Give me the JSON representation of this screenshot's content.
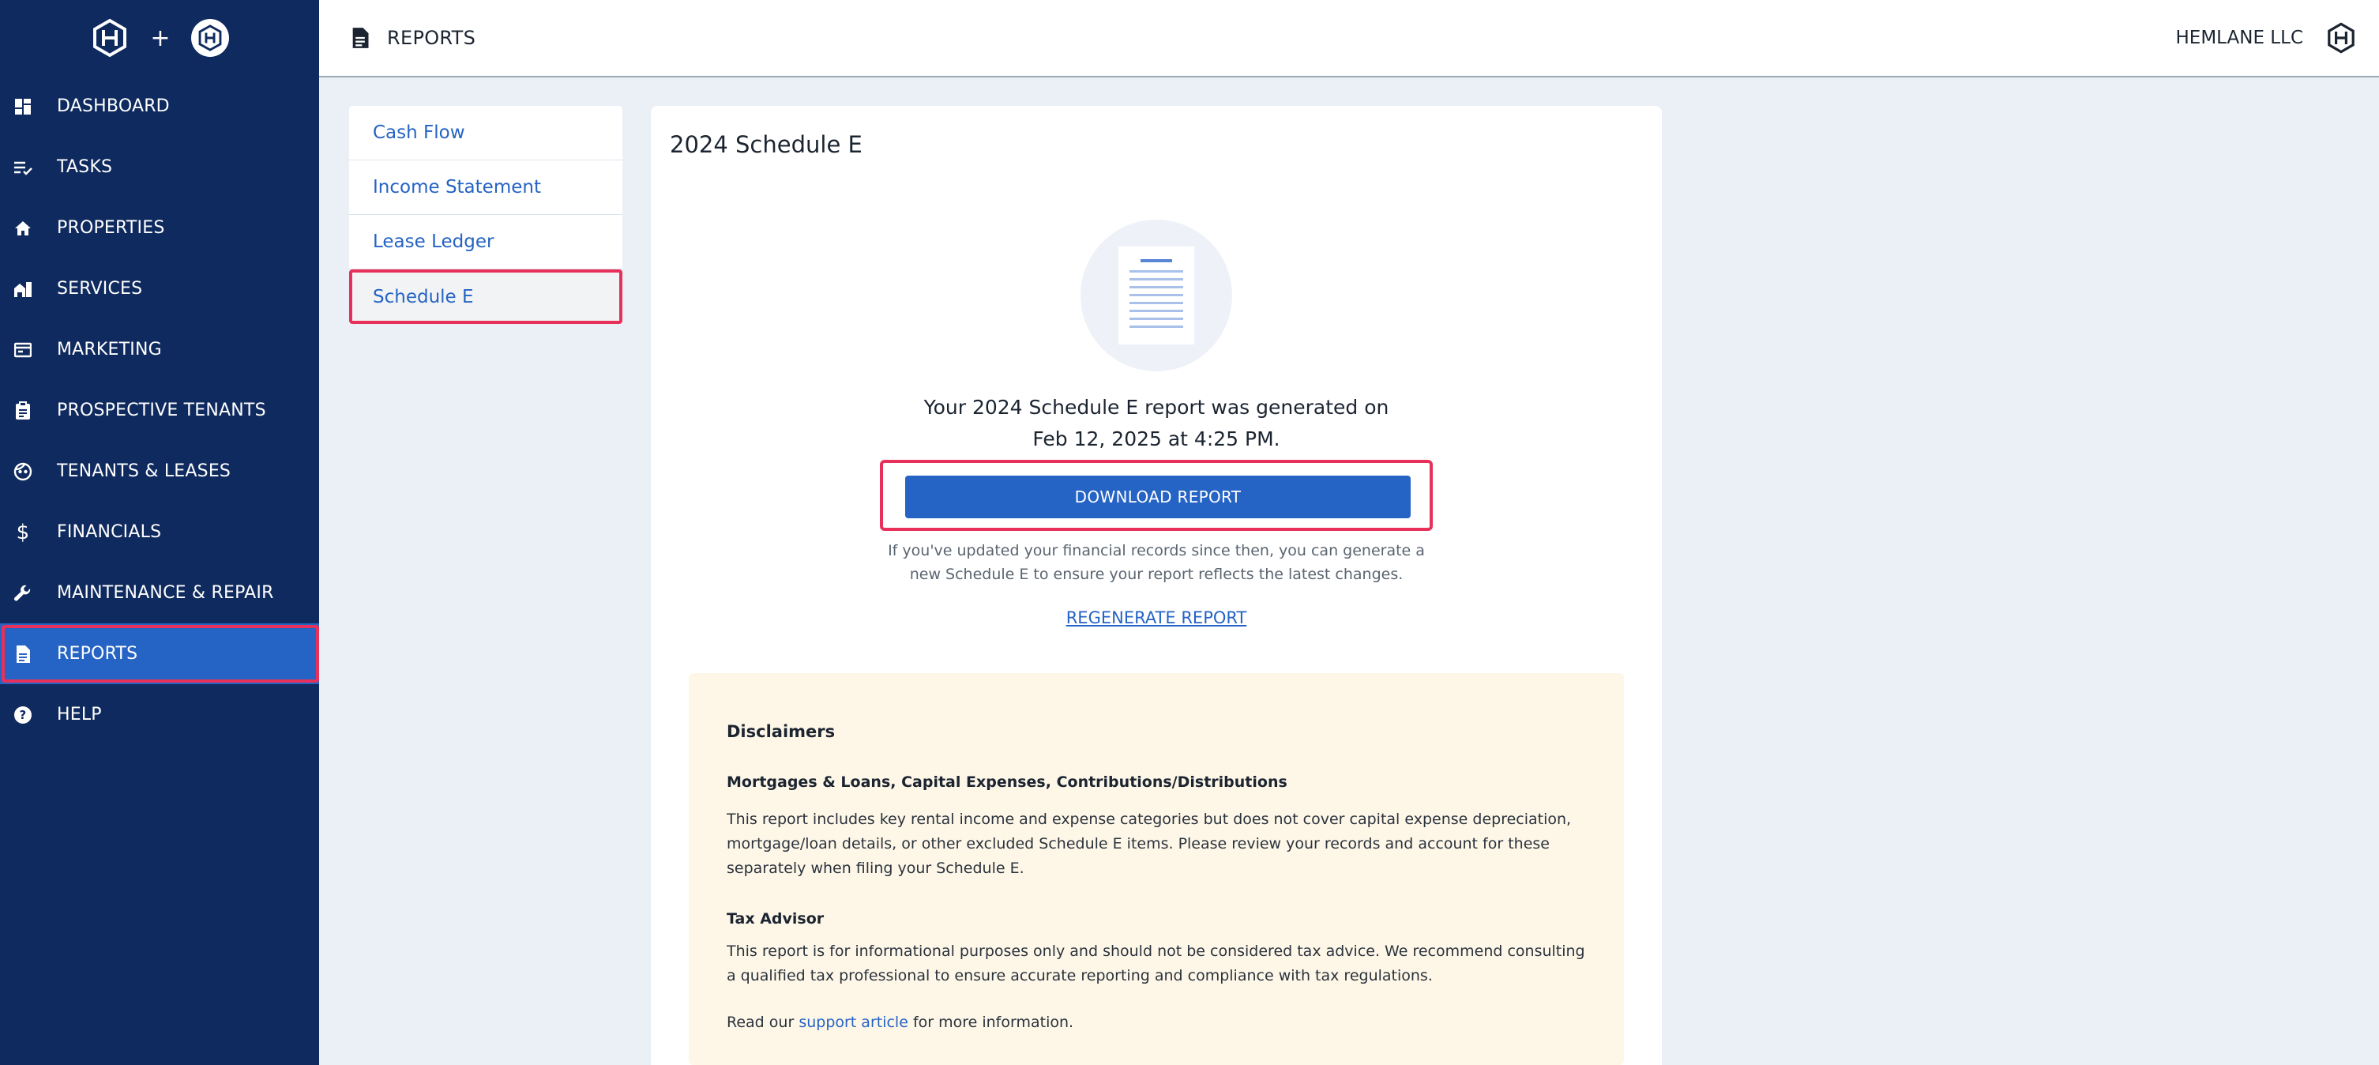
{
  "brand": {
    "plus": "+"
  },
  "sidebar": {
    "items": [
      {
        "label": "DASHBOARD",
        "icon": "dashboard-icon"
      },
      {
        "label": "TASKS",
        "icon": "tasks-icon"
      },
      {
        "label": "PROPERTIES",
        "icon": "home-icon"
      },
      {
        "label": "SERVICES",
        "icon": "services-icon"
      },
      {
        "label": "MARKETING",
        "icon": "marketing-icon"
      },
      {
        "label": "PROSPECTIVE TENANTS",
        "icon": "clipboard-icon"
      },
      {
        "label": "TENANTS & LEASES",
        "icon": "face-icon"
      },
      {
        "label": "FINANCIALS",
        "icon": "dollar-icon"
      },
      {
        "label": "MAINTENANCE & REPAIR",
        "icon": "wrench-icon"
      },
      {
        "label": "REPORTS",
        "icon": "report-icon",
        "active": true
      },
      {
        "label": "HELP",
        "icon": "help-icon"
      }
    ]
  },
  "header": {
    "title": "REPORTS",
    "org": "HEMLANE LLC"
  },
  "report_nav": {
    "items": [
      {
        "label": "Cash Flow"
      },
      {
        "label": "Income Statement"
      },
      {
        "label": "Lease Ledger"
      },
      {
        "label": "Schedule E",
        "active": true
      }
    ]
  },
  "main": {
    "title": "2024 Schedule E",
    "generated_line1": "Your 2024 Schedule E report was generated on",
    "generated_line2": "Feb 12, 2025 at 4:25 PM.",
    "download_label": "DOWNLOAD REPORT",
    "help_line1": "If you've updated your financial records since then, you can generate a",
    "help_line2": "new Schedule E to ensure your report reflects the latest changes.",
    "regenerate_label": "REGENERATE REPORT"
  },
  "disclaimers": {
    "title": "Disclaimers",
    "sub1": "Mortgages & Loans, Capital Expenses, Contributions/Distributions",
    "p1": "This report includes key rental income and expense categories but does not cover capital expense depreciation, mortgage/loan details, or other excluded Schedule E items. Please review your records and account for these separately when filing your Schedule E.",
    "sub2": "Tax Advisor",
    "p2": "This report is for informational purposes only and should not be considered tax advice. We recommend consulting a qualified tax professional to ensure accurate reporting and compliance with tax regulations.",
    "p3_prefix": "Read our ",
    "p3_link": "support article",
    "p3_suffix": " for more information."
  },
  "colors": {
    "sidebar_bg": "#0f2a5e",
    "accent": "#2563c4",
    "highlight": "#e8315a",
    "disclaimer_bg": "#fef7e8"
  }
}
